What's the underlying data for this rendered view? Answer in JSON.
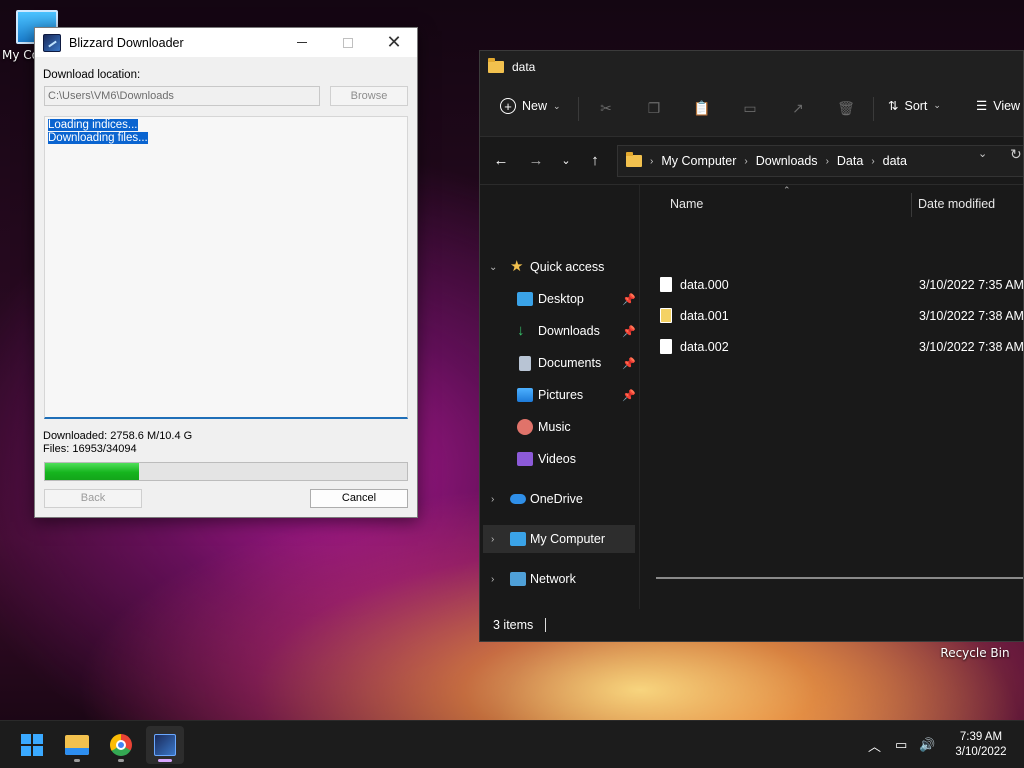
{
  "desktop": {
    "icons": [
      {
        "label": "My Co"
      },
      {
        "label": "Recycle Bin"
      }
    ]
  },
  "downloader": {
    "title": "Blizzard Downloader",
    "location_label": "Download location:",
    "location_value": "C:\\Users\\VM6\\Downloads",
    "browse_label": "Browse",
    "log_lines": [
      "Loading indices...",
      "Downloading files..."
    ],
    "downloaded_text": "Downloaded: 2758.6 M/10.4 G",
    "files_text": "Files: 16953/34094",
    "progress_fraction": 0.26,
    "back_label": "Back",
    "cancel_label": "Cancel"
  },
  "explorer": {
    "title": "data",
    "toolbar": {
      "new_label": "New",
      "sort_label": "Sort",
      "view_label": "View"
    },
    "breadcrumb": [
      "My Computer",
      "Downloads",
      "Data",
      "data"
    ],
    "sidebar": {
      "quick_access": "Quick access",
      "items": [
        {
          "label": "Desktop",
          "icon": "desktop-icon",
          "pinned": true
        },
        {
          "label": "Downloads",
          "icon": "downloads-icon",
          "pinned": true
        },
        {
          "label": "Documents",
          "icon": "documents-icon",
          "pinned": true
        },
        {
          "label": "Pictures",
          "icon": "pictures-icon",
          "pinned": true
        },
        {
          "label": "Music",
          "icon": "music-icon",
          "pinned": false
        },
        {
          "label": "Videos",
          "icon": "videos-icon",
          "pinned": false
        }
      ],
      "onedrive": "OneDrive",
      "my_computer": "My Computer",
      "network": "Network"
    },
    "columns": {
      "name": "Name",
      "date_modified": "Date modified"
    },
    "files": [
      {
        "name": "data.000",
        "date": "3/10/2022 7:35 AM"
      },
      {
        "name": "data.001",
        "date": "3/10/2022 7:38 AM"
      },
      {
        "name": "data.002",
        "date": "3/10/2022 7:38 AM"
      }
    ],
    "status": "3 items"
  },
  "taskbar": {
    "time": "7:39 AM",
    "date": "3/10/2022"
  },
  "colors": {
    "accent": "#0a64d0",
    "progress_green": "#16b51e"
  }
}
